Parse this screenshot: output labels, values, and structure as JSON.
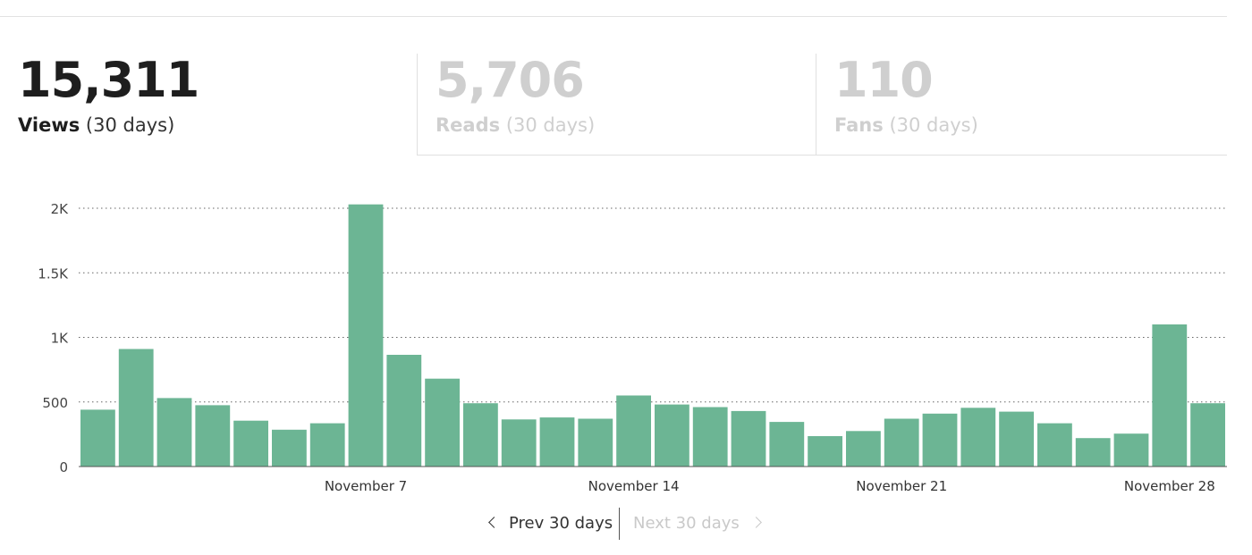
{
  "stats": [
    {
      "value": "15,311",
      "label": "Views",
      "period": "(30 days)",
      "active": true
    },
    {
      "value": "5,706",
      "label": "Reads",
      "period": "(30 days)",
      "active": false
    },
    {
      "value": "110",
      "label": "Fans",
      "period": "(30 days)",
      "active": false
    }
  ],
  "chart_data": {
    "type": "bar",
    "title": "",
    "xlabel": "",
    "ylabel": "",
    "ylim": [
      0,
      2000
    ],
    "yticks": [
      {
        "value": 0,
        "label": "0"
      },
      {
        "value": 500,
        "label": "500"
      },
      {
        "value": 1000,
        "label": "1K"
      },
      {
        "value": 1500,
        "label": "1.5K"
      },
      {
        "value": 2000,
        "label": "2K"
      }
    ],
    "x_tick_labels": [
      {
        "category": "Nov 7",
        "label": "November 7"
      },
      {
        "category": "Nov 14",
        "label": "November 14"
      },
      {
        "category": "Nov 21",
        "label": "November 21"
      },
      {
        "category": "Nov 28",
        "label": "November 28"
      }
    ],
    "grid": true,
    "color": "#6cb594",
    "categories": [
      "Oct 31",
      "Nov 1",
      "Nov 2",
      "Nov 3",
      "Nov 4",
      "Nov 5",
      "Nov 6",
      "Nov 7",
      "Nov 8",
      "Nov 9",
      "Nov 10",
      "Nov 11",
      "Nov 12",
      "Nov 13",
      "Nov 14",
      "Nov 15",
      "Nov 16",
      "Nov 17",
      "Nov 18",
      "Nov 19",
      "Nov 20",
      "Nov 21",
      "Nov 22",
      "Nov 23",
      "Nov 24",
      "Nov 25",
      "Nov 26",
      "Nov 27",
      "Nov 28",
      "Nov 29"
    ],
    "values": [
      440,
      910,
      530,
      475,
      355,
      285,
      335,
      2030,
      865,
      680,
      490,
      365,
      380,
      370,
      550,
      480,
      460,
      430,
      345,
      235,
      275,
      370,
      410,
      455,
      425,
      335,
      220,
      255,
      1100,
      490
    ]
  },
  "pager": {
    "prev": "Prev 30 days",
    "next": "Next 30 days"
  }
}
